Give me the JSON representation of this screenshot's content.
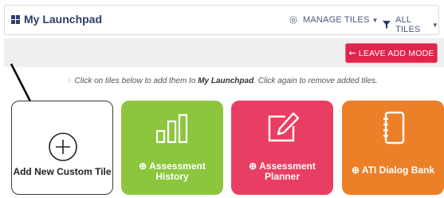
{
  "header": {
    "title": "My Launchpad",
    "manage_tiles": "MANAGE TILES",
    "all_tiles": "ALL TILES"
  },
  "toolbar": {
    "leave_add_mode": "LEAVE ADD MODE"
  },
  "hint": {
    "before": "Click on tiles below to add them to ",
    "emphasis": "My Launchpad",
    "after": ". Click again to remove added tiles."
  },
  "tiles": [
    {
      "label": "Add New Custom Tile",
      "icon": "plus-circle-icon",
      "color": "#ffffff"
    },
    {
      "label": "⊕ Assessment History",
      "icon": "bar-chart-icon",
      "color": "#8cc63f"
    },
    {
      "label": "⊕ Assessment Planner",
      "icon": "edit-icon",
      "color": "#e93e63"
    },
    {
      "label": "⊕ ATI Dialog Bank",
      "icon": "notebook-icon",
      "color": "#ec8028"
    }
  ],
  "colors": {
    "title": "#2c3e6b",
    "leave_button": "#e0244c"
  }
}
